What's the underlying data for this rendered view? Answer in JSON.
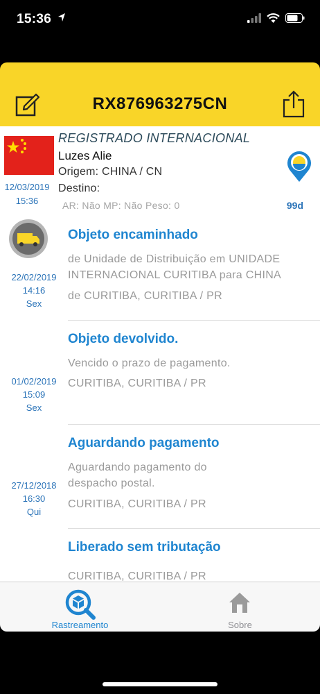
{
  "status_bar": {
    "time": "15:36"
  },
  "header": {
    "title": "RX876963275CN"
  },
  "summary": {
    "type": "REGISTRADO INTERNACIONAL",
    "name": "Luzes Alie",
    "origin": "Origem: CHINA / CN",
    "destination": "Destino:",
    "extra": "AR: Não  MP: Não  Peso: 0",
    "date": "12/03/2019",
    "time": "15:36",
    "days": "99d"
  },
  "events": [
    {
      "title": "Objeto encaminhado",
      "desc": "de Unidade de Distribuição em UNIDADE INTERNACIONAL CURITIBA para CHINA",
      "place": "de CURITIBA, CURITIBA / PR",
      "date": "22/02/2019",
      "time": "14:16",
      "weekday": "Sex"
    },
    {
      "title": "Objeto devolvido.",
      "desc": "Vencido o prazo de pagamento.",
      "place": "CURITIBA, CURITIBA / PR",
      "date": "01/02/2019",
      "time": "15:09",
      "weekday": "Sex"
    },
    {
      "title": "Aguardando pagamento",
      "desc": "Aguardando pagamento do despacho postal.",
      "place": "CURITIBA, CURITIBA / PR",
      "date": "27/12/2018",
      "time": "16:30",
      "weekday": "Qui"
    },
    {
      "title": "Liberado sem tributação",
      "place": "CURITIBA, CURITIBA / PR"
    }
  ],
  "tabs": [
    {
      "label": "Rastreamento",
      "icon": "package-search-icon",
      "active": true,
      "color": "#1f85d0"
    },
    {
      "label": "Sobre",
      "icon": "house-icon",
      "active": false,
      "color": "#8e8e93"
    }
  ],
  "colors": {
    "header": "#f9d528",
    "accent": "#1f85d0"
  }
}
